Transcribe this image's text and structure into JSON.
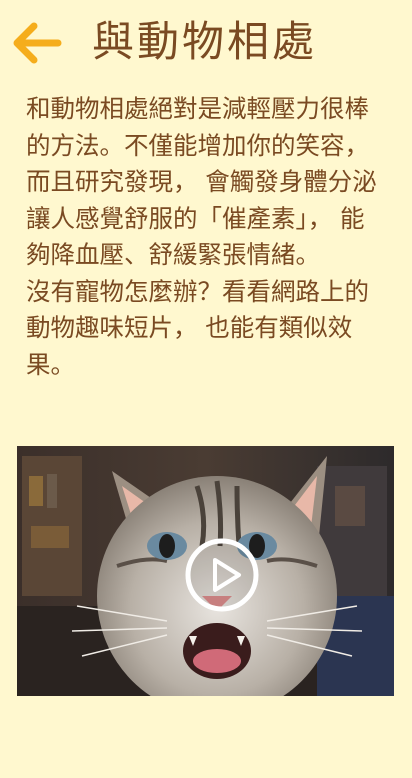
{
  "header": {
    "back_icon": "arrow-left-icon",
    "title": "與動物相處"
  },
  "content": {
    "paragraph_1": "和動物相處絕對是減輕壓力很棒的方法。不僅能增加你的笑容， 而且研究發現， 會觸發身體分泌讓人感覺舒服的「催產素」， 能夠降血壓、舒緩緊張情緒。",
    "paragraph_2": "沒有寵物怎麼辦？看看網路上的動物趣味短片， 也能有類似效果。"
  },
  "video": {
    "thumbnail": "cat-video-thumbnail",
    "play_icon": "play-icon"
  },
  "colors": {
    "background": "#fff8cf",
    "text": "#7a4a22",
    "accent": "#f5ad1c"
  }
}
